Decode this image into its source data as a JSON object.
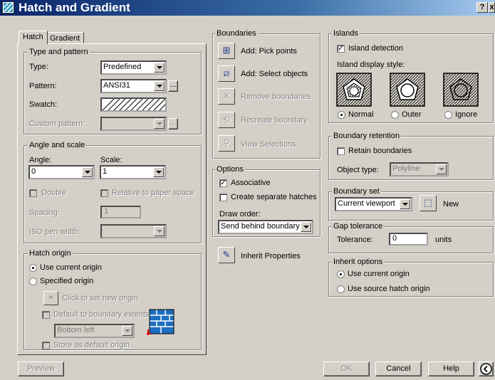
{
  "window": {
    "title": "Hatch and Gradient",
    "help_btn": "?",
    "close_btn": "x"
  },
  "tabs": [
    {
      "label": "Hatch"
    },
    {
      "label": "Gradient"
    }
  ],
  "type_pattern": {
    "group_label": "Type and pattern",
    "type_label": "Type:",
    "type_value": "Predefined",
    "pattern_label": "Pattern:",
    "pattern_value": "ANSI31",
    "pattern_browse": "...",
    "swatch_label": "Swatch:",
    "custom_label": "Custom pattern:",
    "custom_browse": "..."
  },
  "angle_scale": {
    "group_label": "Angle and scale",
    "angle_label": "Angle:",
    "angle_value": "0",
    "scale_label": "Scale:",
    "scale_value": "1",
    "double_label": "Double",
    "relative_label": "Relative to paper space",
    "spacing_label": "Spacing:",
    "spacing_value": "1",
    "iso_label": "ISO pen width:"
  },
  "hatch_origin": {
    "group_label": "Hatch origin",
    "use_current": "Use current origin",
    "specified": "Specified origin",
    "click_set": "Click to set new origin",
    "default_extents": "Default to boundary extents",
    "position_value": "Bottom left",
    "store_default": "Store as default origin"
  },
  "boundaries": {
    "group_label": "Boundaries",
    "pick_points": "Add: Pick points",
    "select_objects": "Add: Select objects",
    "remove": "Remove boundaries",
    "recreate": "Recreate boundary",
    "view": "View Selections"
  },
  "options": {
    "group_label": "Options",
    "associative": "Associative",
    "separate": "Create separate hatches",
    "draw_order_label": "Draw order:",
    "draw_order_value": "Send behind boundary"
  },
  "inherit_props": "Inherit Properties",
  "islands": {
    "group_label": "Islands",
    "detection": "Island detection",
    "style_label": "Island display style:",
    "normal": "Normal",
    "outer": "Outer",
    "ignore": "Ignore"
  },
  "retention": {
    "group_label": "Boundary retention",
    "retain": "Retain boundaries",
    "object_type_label": "Object type:",
    "object_type_value": "Polyline"
  },
  "boundary_set": {
    "group_label": "Boundary set",
    "value": "Current viewport",
    "new_label": "New"
  },
  "gap": {
    "group_label": "Gap tolerance",
    "tolerance_label": "Tolerance:",
    "value": "0",
    "units": "units"
  },
  "inherit_options": {
    "group_label": "Inherit options",
    "use_current": "Use current origin",
    "use_source": "Use source hatch origin"
  },
  "footer": {
    "preview": "Preview",
    "ok": "OK",
    "cancel": "Cancel",
    "help": "Help"
  }
}
